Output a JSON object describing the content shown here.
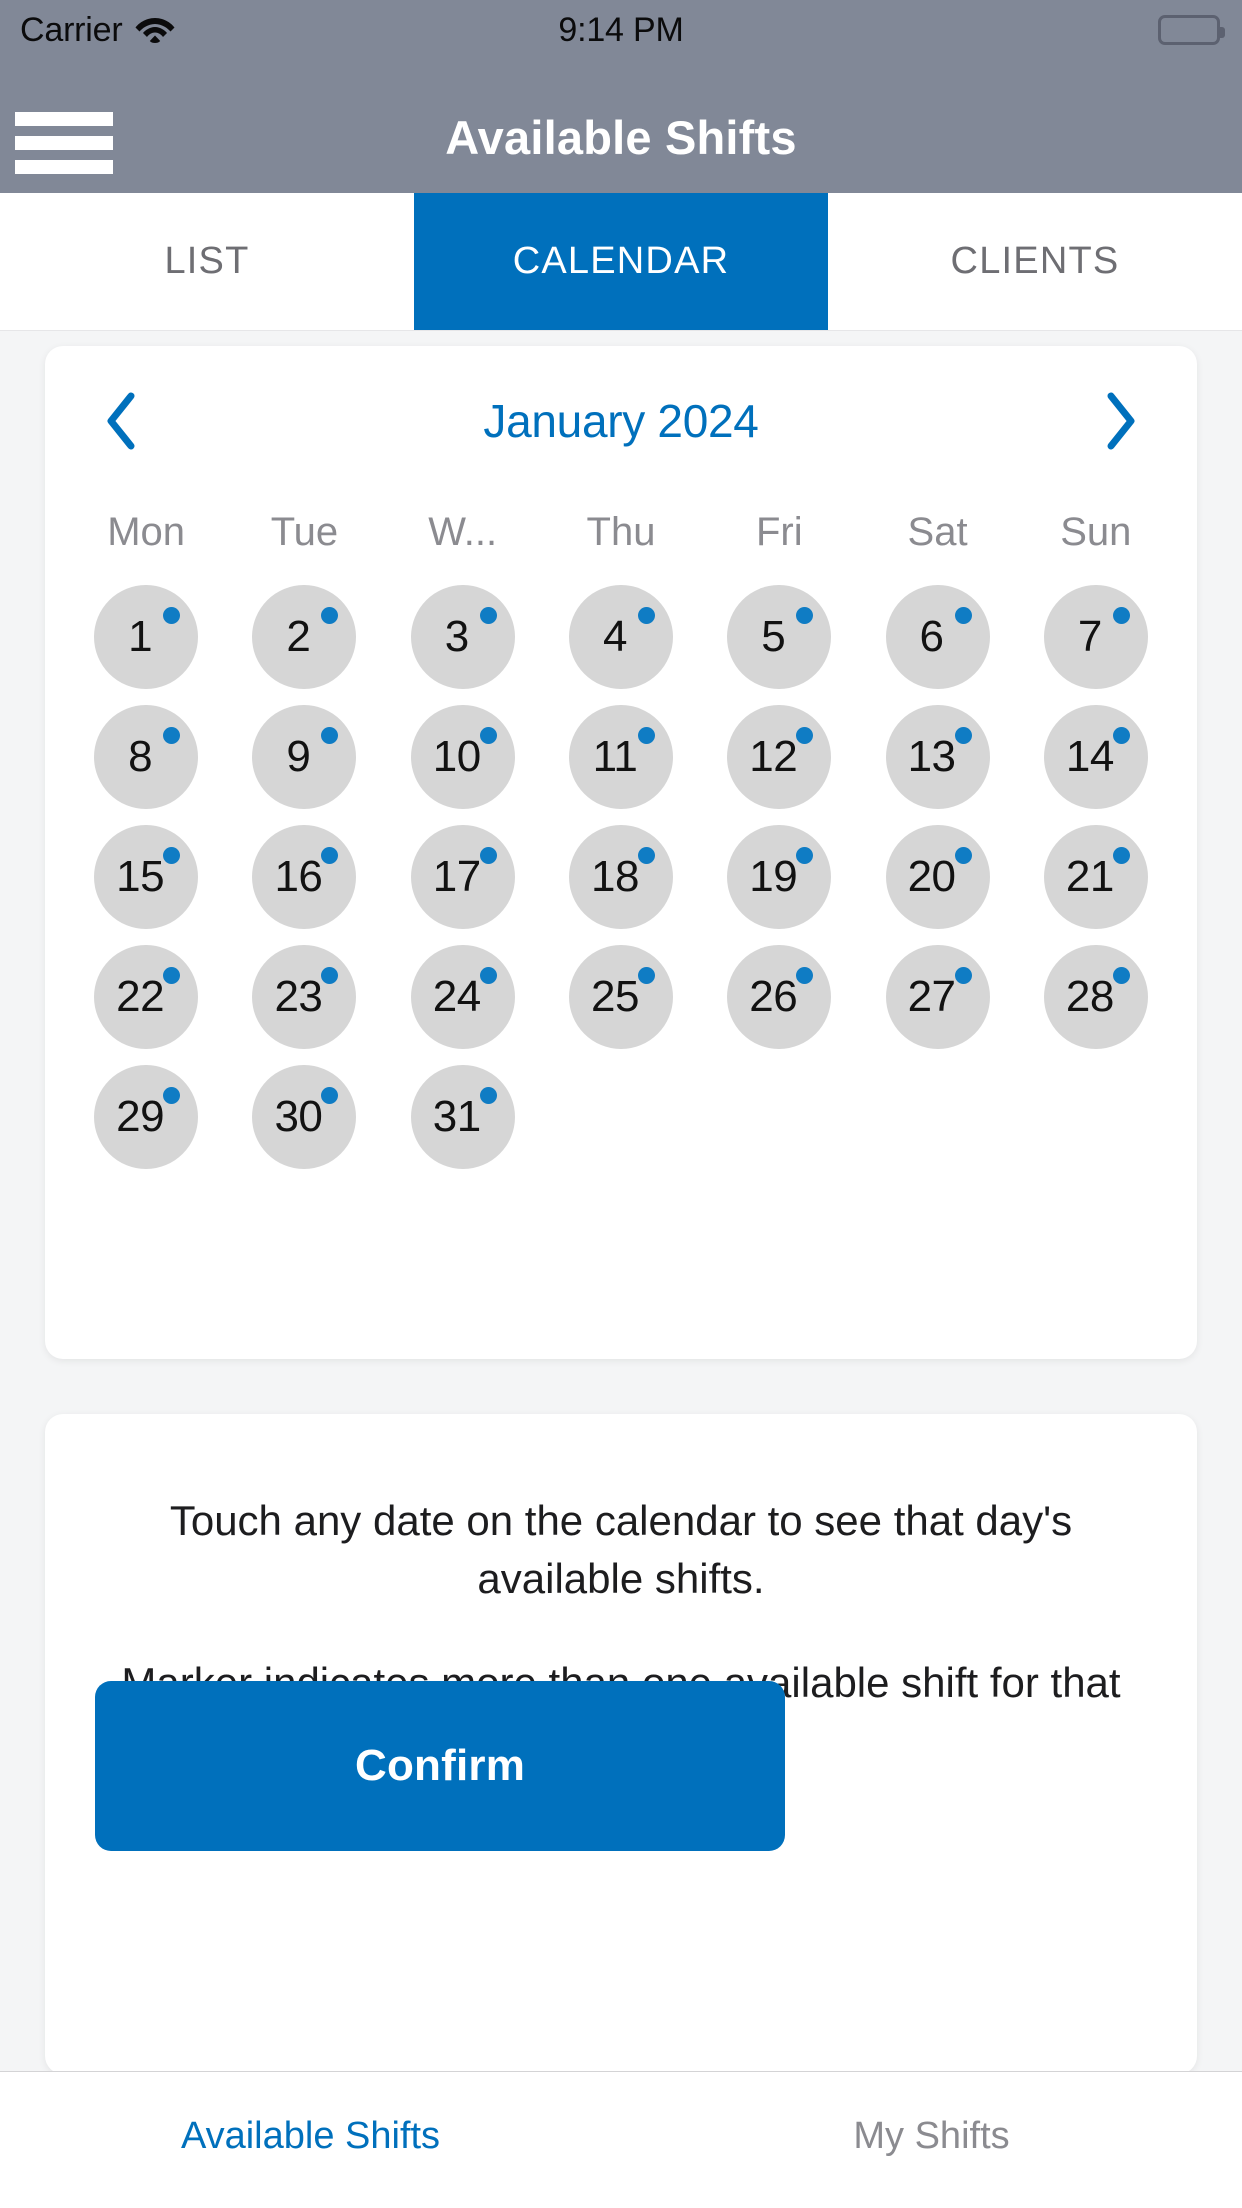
{
  "status_bar": {
    "carrier": "Carrier",
    "wifi_icon": "wifi-icon",
    "time": "9:14 PM",
    "battery_icon": "battery-full-icon"
  },
  "header": {
    "menu_icon": "hamburger-menu-icon",
    "title": "Available Shifts"
  },
  "tabs": [
    {
      "label": "LIST",
      "active": false
    },
    {
      "label": "CALENDAR",
      "active": true
    },
    {
      "label": "CLIENTS",
      "active": false
    }
  ],
  "calendar": {
    "prev_icon": "chevron-left-icon",
    "next_icon": "chevron-right-icon",
    "month_label": "January 2024",
    "weekdays": [
      "Mon",
      "Tue",
      "W...",
      "Thu",
      "Fri",
      "Sat",
      "Sun"
    ],
    "weeks": [
      [
        {
          "day": "1",
          "marker": true
        },
        {
          "day": "2",
          "marker": true
        },
        {
          "day": "3",
          "marker": true
        },
        {
          "day": "4",
          "marker": true
        },
        {
          "day": "5",
          "marker": true
        },
        {
          "day": "6",
          "marker": true
        },
        {
          "day": "7",
          "marker": true
        }
      ],
      [
        {
          "day": "8",
          "marker": true
        },
        {
          "day": "9",
          "marker": true
        },
        {
          "day": "10",
          "marker": true
        },
        {
          "day": "11",
          "marker": true
        },
        {
          "day": "12",
          "marker": true
        },
        {
          "day": "13",
          "marker": true
        },
        {
          "day": "14",
          "marker": true
        }
      ],
      [
        {
          "day": "15",
          "marker": true
        },
        {
          "day": "16",
          "marker": true
        },
        {
          "day": "17",
          "marker": true
        },
        {
          "day": "18",
          "marker": true
        },
        {
          "day": "19",
          "marker": true
        },
        {
          "day": "20",
          "marker": true
        },
        {
          "day": "21",
          "marker": true
        }
      ],
      [
        {
          "day": "22",
          "marker": true
        },
        {
          "day": "23",
          "marker": true
        },
        {
          "day": "24",
          "marker": true
        },
        {
          "day": "25",
          "marker": true
        },
        {
          "day": "26",
          "marker": true
        },
        {
          "day": "27",
          "marker": true
        },
        {
          "day": "28",
          "marker": true
        }
      ],
      [
        {
          "day": "29",
          "marker": true
        },
        {
          "day": "30",
          "marker": true
        },
        {
          "day": "31",
          "marker": true
        },
        {
          "day": "",
          "marker": false
        },
        {
          "day": "",
          "marker": false
        },
        {
          "day": "",
          "marker": false
        },
        {
          "day": "",
          "marker": false
        }
      ]
    ]
  },
  "info_panel": {
    "line1": "Touch any date on the calendar to see that day's available shifts.",
    "line2": "Marker indicates more than one available shift for that date.",
    "confirm_label": "Confirm"
  },
  "bottom_nav": [
    {
      "label": "Available Shifts",
      "active": true
    },
    {
      "label": "My Shifts",
      "active": false
    }
  ],
  "colors": {
    "accent_blue": "#0070bc",
    "header_gray": "#818897",
    "day_circle_gray": "#d6d6d6",
    "marker_blue": "#0f7cc4",
    "page_background": "#f4f5f6"
  }
}
